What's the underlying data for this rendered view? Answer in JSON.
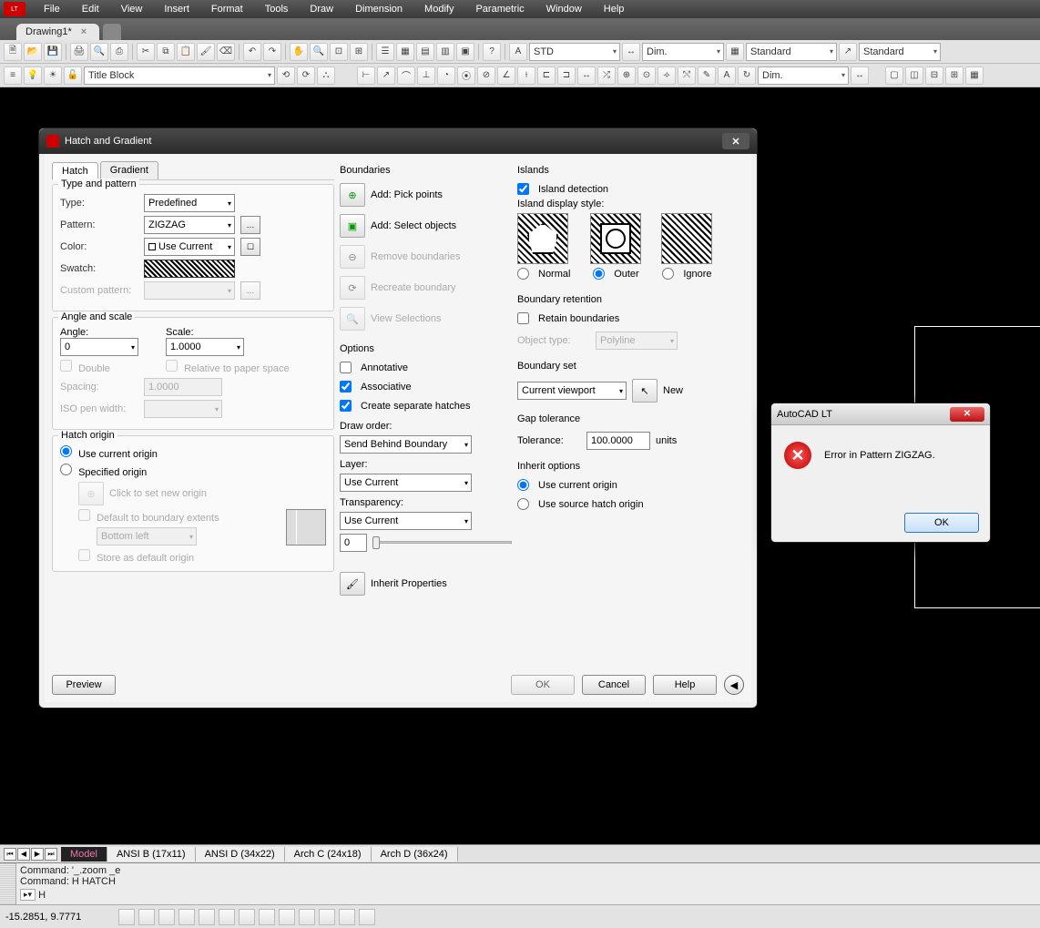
{
  "menu": [
    "File",
    "Edit",
    "View",
    "Insert",
    "Format",
    "Tools",
    "Draw",
    "Dimension",
    "Modify",
    "Parametric",
    "Window",
    "Help"
  ],
  "doc_tab": "Drawing1*",
  "toolbar": {
    "style1": "STD",
    "dim": "Dim.",
    "std": "Standard",
    "std2": "Standard",
    "layer": "Title Block",
    "dim2": "Dim."
  },
  "dialog": {
    "title": "Hatch and Gradient",
    "tabs": [
      "Hatch",
      "Gradient"
    ],
    "group_type": "Type and pattern",
    "lbl_type": "Type:",
    "val_type": "Predefined",
    "lbl_pattern": "Pattern:",
    "val_pattern": "ZIGZAG",
    "lbl_color": "Color:",
    "val_color": "Use Current",
    "lbl_swatch": "Swatch:",
    "lbl_custom": "Custom pattern:",
    "group_angle": "Angle and scale",
    "lbl_angle": "Angle:",
    "val_angle": "0",
    "lbl_scale": "Scale:",
    "val_scale": "1.0000",
    "chk_double": "Double",
    "chk_relpaper": "Relative to paper space",
    "lbl_spacing": "Spacing:",
    "val_spacing": "1.0000",
    "lbl_iso": "ISO pen width:",
    "group_origin": "Hatch origin",
    "rad_cur_origin": "Use current origin",
    "rad_spec_origin": "Specified origin",
    "btn_click_origin": "Click to set new origin",
    "chk_def_ext": "Default to boundary extents",
    "val_def_ext": "Bottom left",
    "chk_store": "Store as default origin",
    "hdr_boundaries": "Boundaries",
    "btn_pick": "Add: Pick points",
    "btn_selobj": "Add: Select objects",
    "btn_remove": "Remove boundaries",
    "btn_recreate": "Recreate boundary",
    "btn_viewsel": "View Selections",
    "hdr_options": "Options",
    "chk_annot": "Annotative",
    "chk_assoc": "Associative",
    "chk_sep": "Create separate hatches",
    "lbl_draworder": "Draw order:",
    "val_draworder": "Send Behind Boundary",
    "lbl_layer": "Layer:",
    "val_layer": "Use Current",
    "lbl_transp": "Transparency:",
    "val_transp": "Use Current",
    "val_transp_num": "0",
    "btn_inherit": "Inherit Properties",
    "hdr_islands": "Islands",
    "chk_island_det": "Island detection",
    "lbl_island_style": "Island display style:",
    "rad_normal": "Normal",
    "rad_outer": "Outer",
    "rad_ignore": "Ignore",
    "hdr_retention": "Boundary retention",
    "chk_retain": "Retain boundaries",
    "lbl_objtype": "Object type:",
    "val_objtype": "Polyline",
    "hdr_bset": "Boundary set",
    "val_bset": "Current viewport",
    "btn_new": "New",
    "hdr_gap": "Gap tolerance",
    "lbl_tol": "Tolerance:",
    "val_tol": "100.0000",
    "lbl_units": "units",
    "hdr_inherit": "Inherit options",
    "rad_inh_cur": "Use current origin",
    "rad_inh_src": "Use source hatch origin",
    "btn_preview": "Preview",
    "btn_ok": "OK",
    "btn_cancel": "Cancel",
    "btn_help": "Help"
  },
  "error": {
    "title": "AutoCAD LT",
    "msg": "Error in Pattern ZIGZAG.",
    "ok": "OK"
  },
  "sheets": [
    "Model",
    "ANSI B (17x11)",
    "ANSI D (34x22)",
    "Arch C (24x18)",
    "Arch D (36x24)"
  ],
  "cmd": {
    "line1": "Command: '_.zoom _e",
    "line2": "Command: H HATCH",
    "prompt": "H"
  },
  "status": {
    "coords": "-15.2851, 9.7771"
  }
}
